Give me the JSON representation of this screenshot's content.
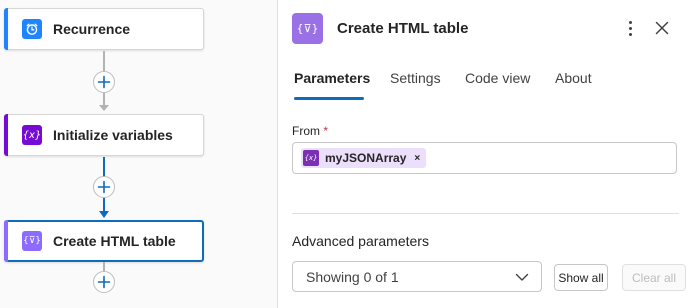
{
  "canvas": {
    "cards": [
      {
        "label": "Recurrence",
        "icon": "alarm-clock-icon",
        "color": "#1f85ff"
      },
      {
        "label": "Initialize variables",
        "icon": "variable-icon",
        "icon_text": "{x}",
        "color": "#770bd6"
      },
      {
        "label": "Create HTML table",
        "icon": "data-operation-icon",
        "icon_text": "{⊽}",
        "color": "#8c6cff",
        "selected": true
      }
    ],
    "line_colors": {
      "default": "#b3b3b3",
      "active": "#0f6cbd"
    }
  },
  "panel": {
    "title": "Create HTML table",
    "icon": "data-operation-icon",
    "icon_text": "{⊽}",
    "icon_color": "#9a70e6",
    "tabs": [
      "Parameters",
      "Settings",
      "Code view",
      "About"
    ],
    "active_tab": "Parameters",
    "from": {
      "label": "From",
      "required_mark": "*",
      "token": {
        "icon_text": "{x}",
        "text": "myJSONArray",
        "remove": "×"
      }
    },
    "advanced": {
      "title": "Advanced parameters",
      "select_value": "Showing 0 of 1",
      "show_all": "Show all",
      "clear_all": "Clear all"
    }
  }
}
